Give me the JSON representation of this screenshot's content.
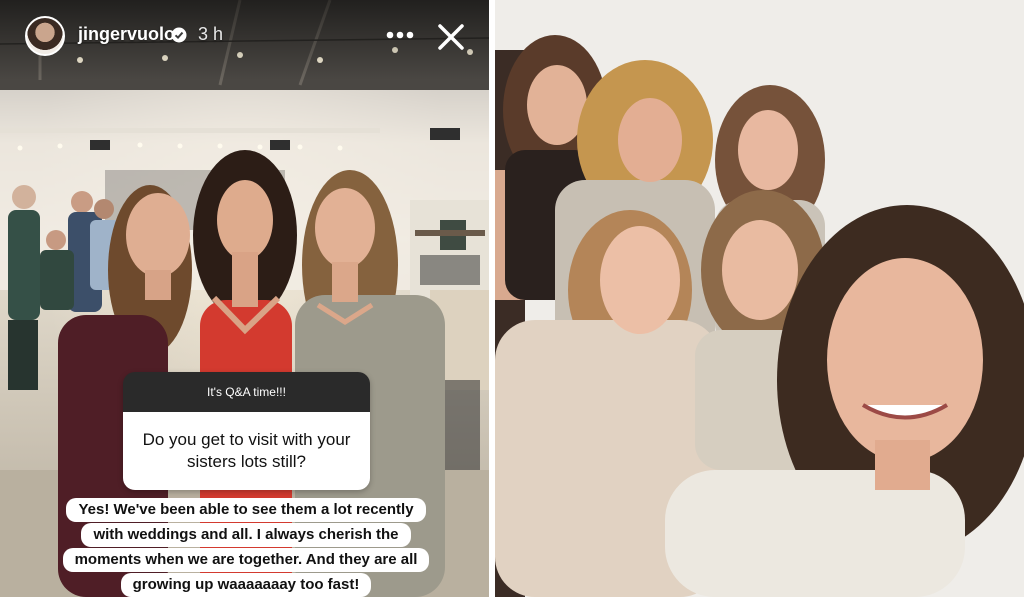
{
  "story": {
    "username": "jingervuolo",
    "time_ago": "3 h",
    "question_header": "It's Q&A time!!!",
    "question": "Do you get to visit with your sisters lots still?",
    "answer_lines": [
      "Yes! We've been able to see them a lot recently",
      "with weddings and all. I always cherish the",
      "moments when we are together. And they are all",
      "growing up waaaaaaay too fast!"
    ]
  },
  "icons": {
    "verified": "verified-badge-icon",
    "more": "more-options-icon",
    "close": "close-icon"
  }
}
